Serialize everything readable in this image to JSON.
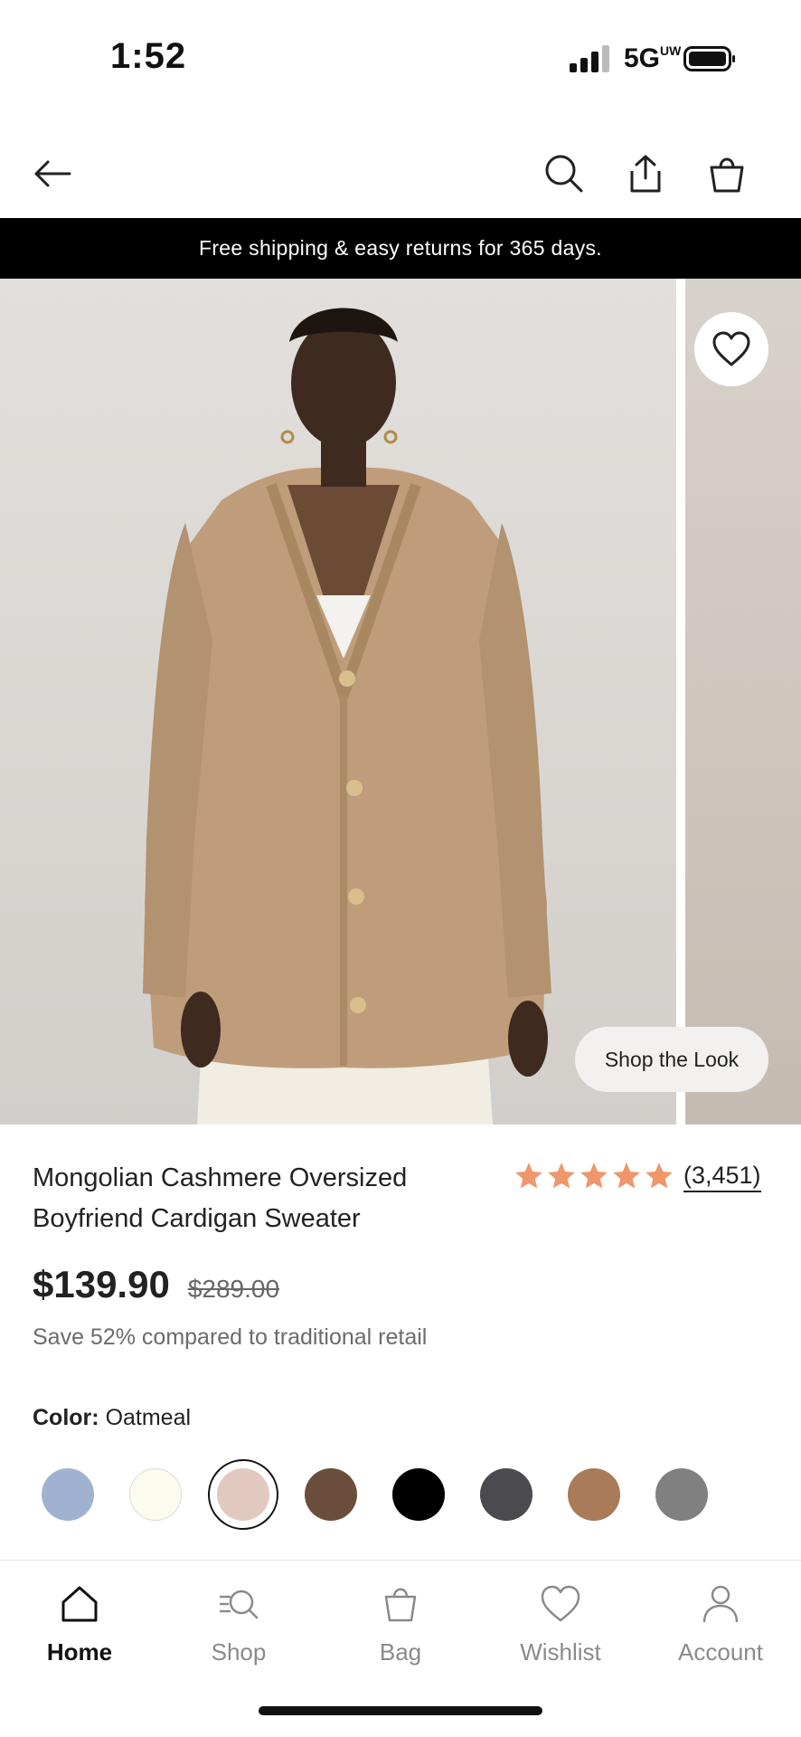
{
  "status": {
    "time": "1:52",
    "network": "5G",
    "network_sub": "UW"
  },
  "nav": {
    "back_icon": "back-arrow-icon",
    "search_icon": "search-icon",
    "share_icon": "share-icon",
    "bag_icon": "bag-icon"
  },
  "promo": {
    "text": "Free shipping & easy returns for 365 days."
  },
  "hero": {
    "shop_the_look": "Shop the Look",
    "wishlist_icon": "heart-icon"
  },
  "product": {
    "title": "Mongolian Cashmere Oversized Boyfriend Cardigan Sweater",
    "rating": 5,
    "review_count": "(3,451)",
    "price": "$139.90",
    "original_price": "$289.00",
    "savings_text": "Save 52% compared to traditional retail",
    "color_label": "Color:",
    "color_value": "Oatmeal",
    "selected_color_index": 2,
    "colors": [
      "#9fb3d1",
      "#fbfbee",
      "#e2c9c0",
      "#6a4d3a",
      "#000000",
      "#4a4a4f",
      "#a97b58",
      "#808080"
    ]
  },
  "tabs": [
    {
      "label": "Home",
      "icon": "home-icon",
      "active": true
    },
    {
      "label": "Shop",
      "icon": "shop-search-icon",
      "active": false
    },
    {
      "label": "Bag",
      "icon": "bag-icon",
      "active": false
    },
    {
      "label": "Wishlist",
      "icon": "heart-icon",
      "active": false
    },
    {
      "label": "Account",
      "icon": "person-icon",
      "active": false
    }
  ],
  "colors": {
    "star": "#f0966b",
    "banner_bg": "#000000"
  }
}
